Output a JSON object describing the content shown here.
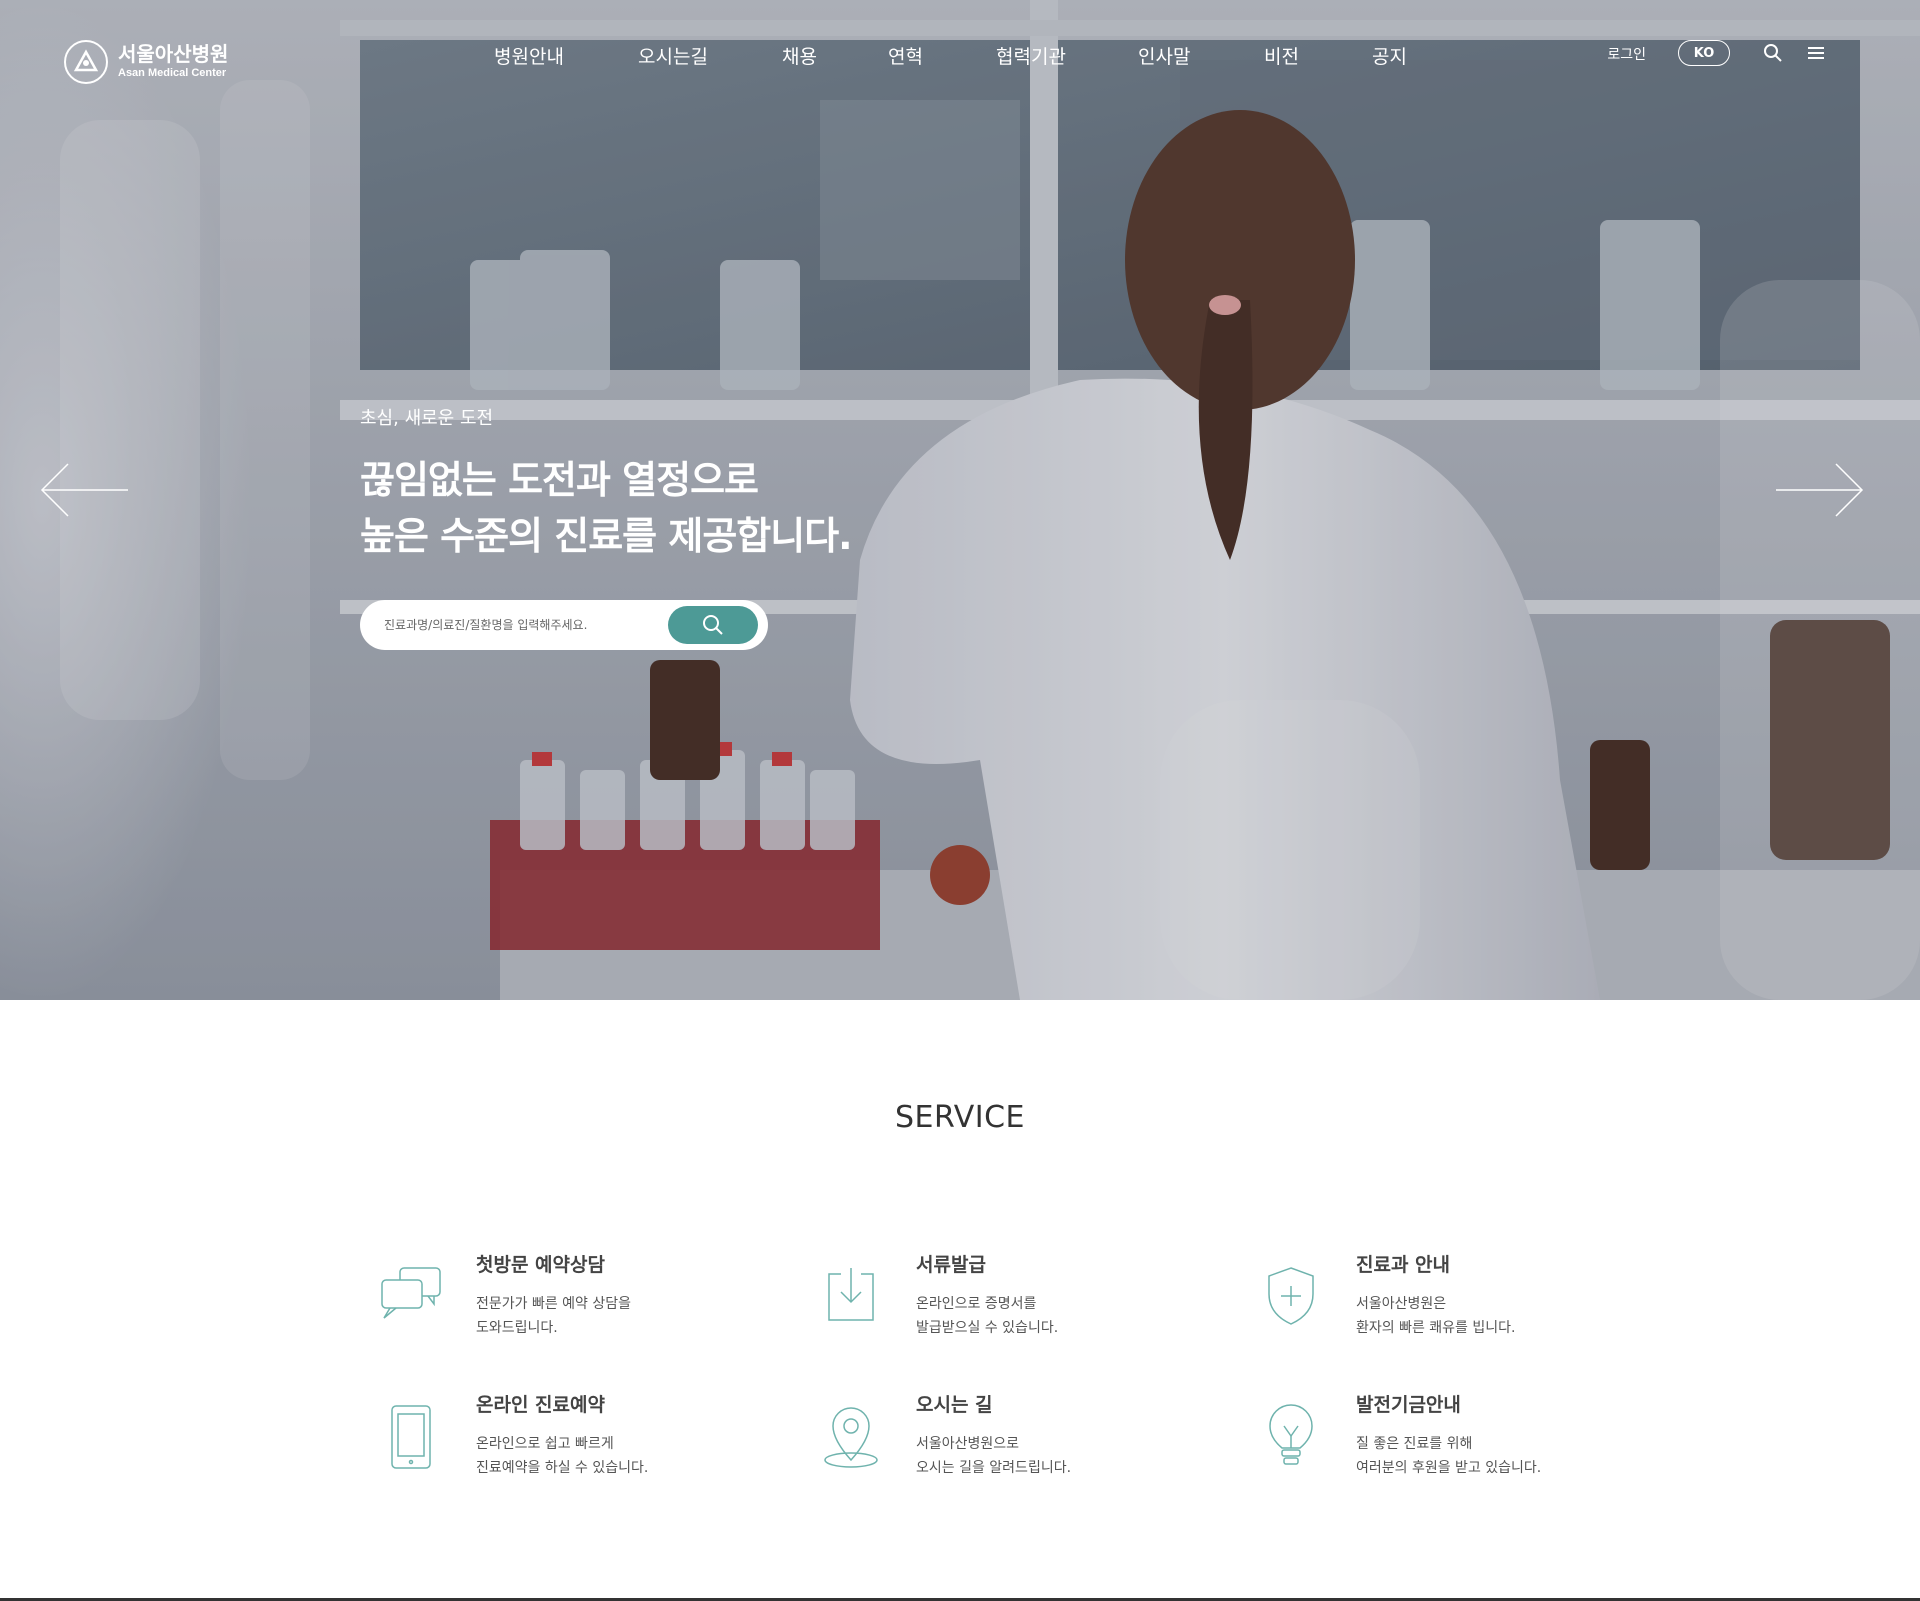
{
  "brand": {
    "name_ko": "서울아산병원",
    "name_en": "Asan Medical Center"
  },
  "nav": {
    "items": [
      "병원안내",
      "오시는길",
      "채용",
      "연혁",
      "협력기관",
      "인사말",
      "비전",
      "공지"
    ]
  },
  "util": {
    "login": "로그인",
    "lang": "KO"
  },
  "hero": {
    "subtitle": "초심, 새로운 도전",
    "title_line1": "끊임없는 도전과 열정으로",
    "title_line2": "높은 수준의 진료를 제공합니다.",
    "search_placeholder": "진료과명/의료진/질환명을 입력해주세요."
  },
  "service": {
    "heading": "SERVICE",
    "items": [
      {
        "title": "첫방문 예약상담",
        "desc1": "전문가가 빠른 예약 상담을",
        "desc2": "도와드립니다.",
        "icon": "chat-bubbles-icon"
      },
      {
        "title": "서류발급",
        "desc1": "온라인으로 증명서를",
        "desc2": "발급받으실 수 있습니다.",
        "icon": "download-document-icon"
      },
      {
        "title": "진료과 안내",
        "desc1": "서울아산병원은",
        "desc2": "환자의 빠른 쾌유를 빕니다.",
        "icon": "shield-cross-icon"
      },
      {
        "title": "온라인 진료예약",
        "desc1": "온라인으로 쉽고 빠르게",
        "desc2": "진료예약을 하실 수 있습니다.",
        "icon": "tablet-icon"
      },
      {
        "title": "오시는 길",
        "desc1": "서울아산병원으로",
        "desc2": "오시는 길을 알려드립니다.",
        "icon": "location-pin-icon"
      },
      {
        "title": "발전기금안내",
        "desc1": "질 좋은 진료를 위해",
        "desc2": "여러분의 후원을 받고 있습니다.",
        "icon": "lightbulb-icon"
      }
    ]
  },
  "colors": {
    "accent": "#4d9a96",
    "icon_stroke": "#6fb3ad"
  }
}
